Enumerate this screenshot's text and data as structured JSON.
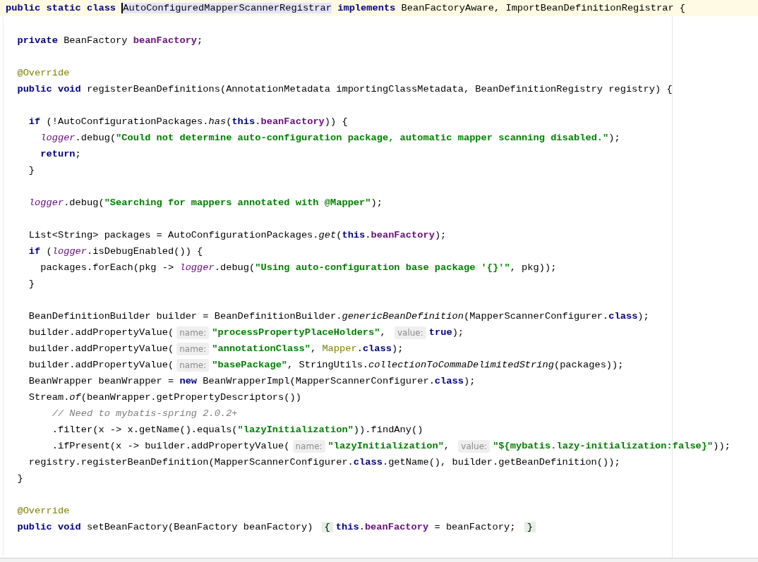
{
  "editor": {
    "lines": [
      {
        "current": true,
        "tokens": [
          {
            "kind": "keyword",
            "text": "public static class "
          },
          {
            "kind": "usage",
            "caret": true,
            "text": "AutoConfiguredMapperScannerRegistrar"
          },
          {
            "kind": "keyword",
            "text": " implements "
          },
          {
            "kind": "plain",
            "text": "BeanFactoryAware, ImportBeanDefinitionRegistrar {"
          }
        ]
      },
      {
        "current": false,
        "kind": "blank"
      },
      {
        "current": false,
        "tokens": [
          {
            "kind": "keyword",
            "text": "  private"
          },
          {
            "kind": "plain",
            "text": " BeanFactory "
          },
          {
            "kind": "field",
            "text": "beanFactory"
          },
          {
            "kind": "plain",
            "text": ";"
          }
        ]
      },
      {
        "current": false,
        "kind": "blank"
      },
      {
        "current": false,
        "tokens": [
          {
            "kind": "annotation",
            "text": "  @Override"
          }
        ]
      },
      {
        "current": false,
        "tokens": [
          {
            "kind": "keyword",
            "text": "  public void"
          },
          {
            "kind": "plain",
            "text": " registerBeanDefinitions(AnnotationMetadata importingClassMetadata, BeanDefinitionRegistry registry) {"
          }
        ]
      },
      {
        "current": false,
        "kind": "blank"
      },
      {
        "current": false,
        "tokens": [
          {
            "kind": "keyword",
            "text": "    if"
          },
          {
            "kind": "plain",
            "text": " (!AutoConfigurationPackages."
          },
          {
            "kind": "static_method",
            "text": "has"
          },
          {
            "kind": "plain",
            "text": "("
          },
          {
            "kind": "keyword",
            "text": "this"
          },
          {
            "kind": "plain",
            "text": "."
          },
          {
            "kind": "field",
            "text": "beanFactory"
          },
          {
            "kind": "plain",
            "text": ")) {"
          }
        ]
      },
      {
        "current": false,
        "tokens": [
          {
            "kind": "static_field",
            "text": "      logger"
          },
          {
            "kind": "plain",
            "text": ".debug("
          },
          {
            "kind": "string",
            "text": "\"Could not determine auto-configuration package, automatic mapper scanning disabled.\""
          },
          {
            "kind": "plain",
            "text": ");"
          }
        ]
      },
      {
        "current": false,
        "tokens": [
          {
            "kind": "keyword",
            "text": "      return"
          },
          {
            "kind": "plain",
            "text": ";"
          }
        ]
      },
      {
        "current": false,
        "tokens": [
          {
            "kind": "plain",
            "text": "    }"
          }
        ]
      },
      {
        "current": false,
        "kind": "blank"
      },
      {
        "current": false,
        "tokens": [
          {
            "kind": "static_field",
            "text": "    logger"
          },
          {
            "kind": "plain",
            "text": ".debug("
          },
          {
            "kind": "string",
            "text": "\"Searching for mappers annotated with @Mapper\""
          },
          {
            "kind": "plain",
            "text": ");"
          }
        ]
      },
      {
        "current": false,
        "kind": "blank"
      },
      {
        "current": false,
        "tokens": [
          {
            "kind": "plain",
            "text": "    List<String> packages = AutoConfigurationPackages."
          },
          {
            "kind": "static_method",
            "text": "get"
          },
          {
            "kind": "plain",
            "text": "("
          },
          {
            "kind": "keyword",
            "text": "this"
          },
          {
            "kind": "plain",
            "text": "."
          },
          {
            "kind": "field",
            "text": "beanFactory"
          },
          {
            "kind": "plain",
            "text": ");"
          }
        ]
      },
      {
        "current": false,
        "tokens": [
          {
            "kind": "keyword",
            "text": "    if"
          },
          {
            "kind": "plain",
            "text": " ("
          },
          {
            "kind": "static_field",
            "text": "logger"
          },
          {
            "kind": "plain",
            "text": ".isDebugEnabled()) {"
          }
        ]
      },
      {
        "current": false,
        "tokens": [
          {
            "kind": "plain",
            "text": "      packages.forEach(pkg -> "
          },
          {
            "kind": "static_field",
            "text": "logger"
          },
          {
            "kind": "plain",
            "text": ".debug("
          },
          {
            "kind": "string",
            "text": "\"Using auto-configuration base package '{}'\""
          },
          {
            "kind": "plain",
            "text": ", pkg));"
          }
        ]
      },
      {
        "current": false,
        "tokens": [
          {
            "kind": "plain",
            "text": "    }"
          }
        ]
      },
      {
        "current": false,
        "kind": "blank"
      },
      {
        "current": false,
        "tokens": [
          {
            "kind": "plain",
            "text": "    BeanDefinitionBuilder builder = BeanDefinitionBuilder."
          },
          {
            "kind": "static_method",
            "text": "genericBeanDefinition"
          },
          {
            "kind": "plain",
            "text": "(MapperScannerConfigurer."
          },
          {
            "kind": "keyword",
            "text": "class"
          },
          {
            "kind": "plain",
            "text": ");"
          }
        ]
      },
      {
        "current": false,
        "tokens": [
          {
            "kind": "plain",
            "text": "    builder.addPropertyValue("
          },
          {
            "kind": "hint",
            "text": "name:"
          },
          {
            "kind": "string",
            "text": "\"processPropertyPlaceHolders\""
          },
          {
            "kind": "plain",
            "text": ", "
          },
          {
            "kind": "hint",
            "text": "value:"
          },
          {
            "kind": "keyword",
            "text": "true"
          },
          {
            "kind": "plain",
            "text": ");"
          }
        ]
      },
      {
        "current": false,
        "tokens": [
          {
            "kind": "plain",
            "text": "    builder.addPropertyValue("
          },
          {
            "kind": "hint",
            "text": "name:"
          },
          {
            "kind": "string",
            "text": "\"annotationClass\""
          },
          {
            "kind": "plain",
            "text": ", "
          },
          {
            "kind": "annotation",
            "text": "Mapper"
          },
          {
            "kind": "plain",
            "text": "."
          },
          {
            "kind": "keyword",
            "text": "class"
          },
          {
            "kind": "plain",
            "text": ");"
          }
        ]
      },
      {
        "current": false,
        "tokens": [
          {
            "kind": "plain",
            "text": "    builder.addPropertyValue("
          },
          {
            "kind": "hint",
            "text": "name:"
          },
          {
            "kind": "string",
            "text": "\"basePackage\""
          },
          {
            "kind": "plain",
            "text": ", StringUtils."
          },
          {
            "kind": "static_method",
            "text": "collectionToCommaDelimitedString"
          },
          {
            "kind": "plain",
            "text": "(packages));"
          }
        ]
      },
      {
        "current": false,
        "tokens": [
          {
            "kind": "plain",
            "text": "    BeanWrapper beanWrapper = "
          },
          {
            "kind": "keyword",
            "text": "new"
          },
          {
            "kind": "plain",
            "text": " BeanWrapperImpl(MapperScannerConfigurer."
          },
          {
            "kind": "keyword",
            "text": "class"
          },
          {
            "kind": "plain",
            "text": ");"
          }
        ]
      },
      {
        "current": false,
        "tokens": [
          {
            "kind": "plain",
            "text": "    Stream."
          },
          {
            "kind": "static_method",
            "text": "of"
          },
          {
            "kind": "plain",
            "text": "(beanWrapper.getPropertyDescriptors())"
          }
        ]
      },
      {
        "current": false,
        "tokens": [
          {
            "kind": "comment",
            "text": "        // Need to mybatis-spring 2.0.2+"
          }
        ]
      },
      {
        "current": false,
        "tokens": [
          {
            "kind": "plain",
            "text": "        .filter(x -> x.getName().equals("
          },
          {
            "kind": "string",
            "text": "\"lazyInitialization\""
          },
          {
            "kind": "plain",
            "text": ")).findAny()"
          }
        ]
      },
      {
        "current": false,
        "tokens": [
          {
            "kind": "plain",
            "text": "        .ifPresent(x -> builder.addPropertyValue("
          },
          {
            "kind": "hint",
            "text": "name:"
          },
          {
            "kind": "string",
            "text": "\"lazyInitialization\""
          },
          {
            "kind": "plain",
            "text": ", "
          },
          {
            "kind": "hint",
            "text": "value:"
          },
          {
            "kind": "string",
            "text": "\"${mybatis.lazy-initialization:false}\""
          },
          {
            "kind": "plain",
            "text": "));"
          }
        ]
      },
      {
        "current": false,
        "tokens": [
          {
            "kind": "plain",
            "text": "    registry.registerBeanDefinition(MapperScannerConfigurer."
          },
          {
            "kind": "keyword",
            "text": "class"
          },
          {
            "kind": "plain",
            "text": ".getName(), builder.getBeanDefinition());"
          }
        ]
      },
      {
        "current": false,
        "tokens": [
          {
            "kind": "plain",
            "text": "  }"
          }
        ]
      },
      {
        "current": false,
        "kind": "blank"
      },
      {
        "current": false,
        "tokens": [
          {
            "kind": "annotation",
            "text": "  @Override"
          }
        ]
      },
      {
        "current": false,
        "tokens": [
          {
            "kind": "keyword",
            "text": "  public void"
          },
          {
            "kind": "plain",
            "text": " setBeanFactory(BeanFactory beanFactory) "
          },
          {
            "kind": "fold",
            "text": "{"
          },
          {
            "kind": "keyword",
            "text": "this"
          },
          {
            "kind": "plain",
            "text": "."
          },
          {
            "kind": "field",
            "text": "beanFactory"
          },
          {
            "kind": "plain",
            "text": " = beanFactory; "
          },
          {
            "kind": "fold",
            "text": "}"
          }
        ]
      }
    ]
  }
}
